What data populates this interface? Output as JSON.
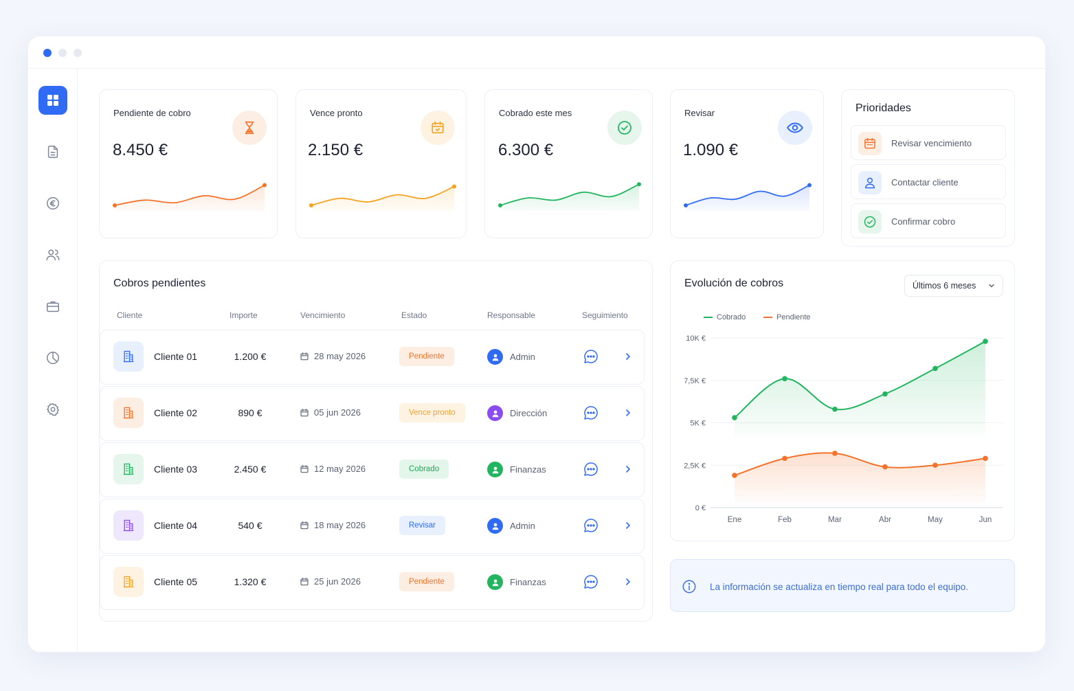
{
  "window": {
    "dots": [
      {
        "name": "window-dot-active",
        "color": "#2f6bf5"
      },
      {
        "name": "window-dot-2",
        "color": "#e6e9ef"
      },
      {
        "name": "window-dot-3",
        "color": "#e6e9ef"
      }
    ]
  },
  "sidebar": {
    "items": [
      {
        "icon": "grid-icon",
        "active": true
      },
      {
        "icon": "document-icon",
        "active": false
      },
      {
        "icon": "euro-icon",
        "active": false
      },
      {
        "icon": "users-icon",
        "active": false
      },
      {
        "icon": "briefcase-icon",
        "active": false
      },
      {
        "icon": "pie-chart-icon",
        "active": false
      },
      {
        "icon": "settings-icon",
        "active": false
      }
    ]
  },
  "kpis": [
    {
      "label": "Pendiente de cobro",
      "value": "8.450 €",
      "icon": "hourglass-icon",
      "color": "#f4732a",
      "bg": "#fdeee4",
      "trend": [
        2,
        3.2,
        2.6,
        4.2,
        3.4,
        6.6
      ]
    },
    {
      "label": "Vence pronto",
      "value": "2.150 €",
      "icon": "calendar-icon",
      "color": "#f5a31f",
      "bg": "#fef2e2",
      "trend": [
        2,
        3.6,
        2.8,
        4.4,
        3.6,
        6.3
      ]
    },
    {
      "label": "Cobrado este mes",
      "value": "6.300 €",
      "icon": "check-circle-icon",
      "color": "#22b55f",
      "bg": "#e6f6ec",
      "trend": [
        2,
        3.7,
        3.2,
        5.0,
        4.0,
        6.8
      ]
    },
    {
      "label": "Revisar",
      "value": "1.090 €",
      "icon": "eye-icon",
      "color": "#2f6bf5",
      "bg": "#e8effd",
      "trend": [
        2,
        3.7,
        3.4,
        5.2,
        4.1,
        6.6
      ]
    }
  ],
  "priorities": {
    "title": "Prioridades",
    "items": [
      {
        "label": "Revisar vencimiento",
        "icon": "calendar-icon",
        "color": "#f4732a",
        "bg": "#fdeee4"
      },
      {
        "label": "Contactar cliente",
        "icon": "user-icon",
        "color": "#2f6bf5",
        "bg": "#e8effd"
      },
      {
        "label": "Confirmar cobro",
        "icon": "check-circle-icon",
        "color": "#22b55f",
        "bg": "#e6f6ec"
      }
    ]
  },
  "collections": {
    "title": "Cobros pendientes",
    "columns": [
      "Cliente",
      "Importe",
      "Vencimiento",
      "Estado",
      "Responsable",
      "Seguimiento"
    ],
    "rows": [
      {
        "client": "Cliente 01",
        "amount": "1.200 €",
        "due": "28 may 2026",
        "status": "Pendiente",
        "status_fg": "#f4732a",
        "status_bg": "#fdeee4",
        "owner": "Admin",
        "owner_color": "#2f6bf5",
        "bld_color": "#2f6bf5",
        "bld_bg": "#e8effd"
      },
      {
        "client": "Cliente 02",
        "amount": "890 €",
        "due": "05 jun 2026",
        "status": "Vence pronto",
        "status_fg": "#f5a31f",
        "status_bg": "#fef2e2",
        "owner": "Dirección",
        "owner_color": "#8b4cf0",
        "bld_color": "#f4732a",
        "bld_bg": "#fdeee4"
      },
      {
        "client": "Cliente 03",
        "amount": "2.450 €",
        "due": "12 may 2026",
        "status": "Cobrado",
        "status_fg": "#1fa855",
        "status_bg": "#e4f5ea",
        "owner": "Finanzas",
        "owner_color": "#22b55f",
        "bld_color": "#22b55f",
        "bld_bg": "#e6f6ec"
      },
      {
        "client": "Cliente 04",
        "amount": "540 €",
        "due": "18 may 2026",
        "status": "Revisar",
        "status_fg": "#2f6bf5",
        "status_bg": "#e8effd",
        "owner": "Admin",
        "owner_color": "#2f6bf5",
        "bld_color": "#8b4cf0",
        "bld_bg": "#efe8fd"
      },
      {
        "client": "Cliente 05",
        "amount": "1.320 €",
        "due": "25 jun 2026",
        "status": "Pendiente",
        "status_fg": "#f4732a",
        "status_bg": "#fdeee4",
        "owner": "Finanzas",
        "owner_color": "#22b55f",
        "bld_color": "#f5a31f",
        "bld_bg": "#fef2e2"
      }
    ]
  },
  "evolution": {
    "title": "Evolución de cobros",
    "period": "Últimos 6 meses"
  },
  "chart_data": {
    "type": "area",
    "categories": [
      "Ene",
      "Feb",
      "Mar",
      "Abr",
      "May",
      "Jun"
    ],
    "ytick_labels": [
      "0  €",
      "2,5K  €",
      "5K  €",
      "7,5K  €",
      "10K  €"
    ],
    "ytick_values": [
      0,
      2500,
      5000,
      7500,
      10000
    ],
    "ylim": [
      0,
      10000
    ],
    "grid": true,
    "legend": "top-left",
    "series": [
      {
        "name": "Cobrado",
        "color": "#22b55f",
        "values": [
          5300,
          7600,
          5800,
          6700,
          8200,
          9800
        ]
      },
      {
        "name": "Pendiente",
        "color": "#f4732a",
        "values": [
          1900,
          2900,
          3200,
          2400,
          2500,
          2900
        ]
      }
    ]
  },
  "info": {
    "text": "La información se actualiza en tiempo real para todo el equipo."
  }
}
